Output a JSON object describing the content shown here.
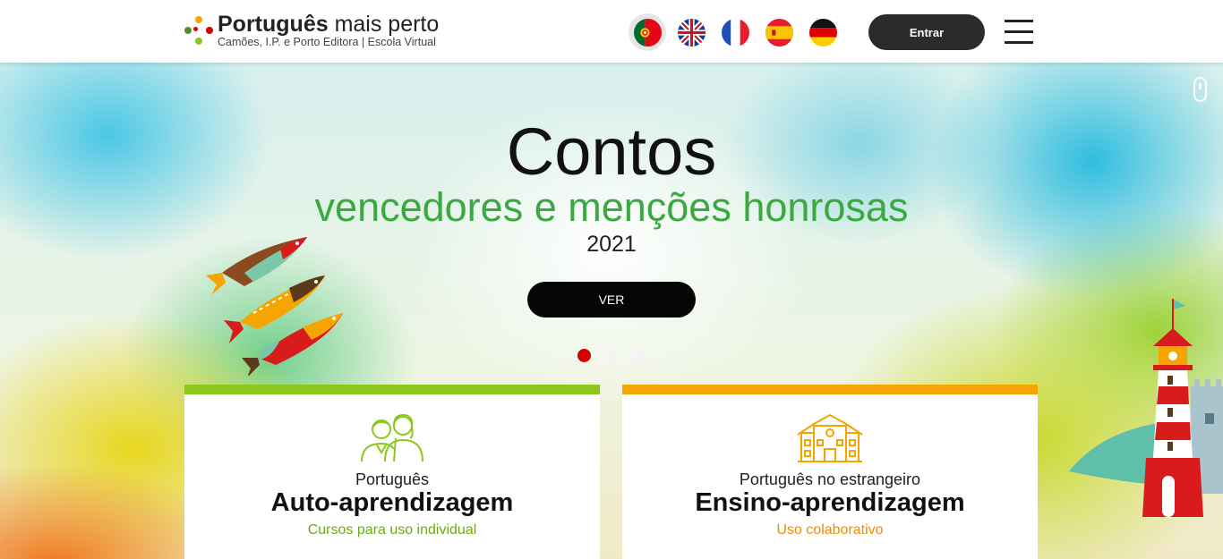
{
  "header": {
    "logo_title_bold": "Português",
    "logo_title_rest": " mais perto",
    "logo_subtitle": "Camões, I.P. e Porto Editora | Escola Virtual",
    "flags": [
      {
        "name": "portuguese",
        "active": true
      },
      {
        "name": "english",
        "active": false
      },
      {
        "name": "french",
        "active": false
      },
      {
        "name": "spanish",
        "active": false
      },
      {
        "name": "german",
        "active": false
      }
    ],
    "login_label": "Entrar",
    "menu_icon": "hamburger-menu-icon"
  },
  "hero": {
    "title": "Contos",
    "subtitle": "vencedores e menções honrosas",
    "year": "2021",
    "button_label": "VER",
    "slides": 3,
    "active_slide": 1
  },
  "cards": [
    {
      "accent": "#8cc71d",
      "icon": "people-icon",
      "pre": "Português",
      "title": "Auto-aprendizagem",
      "note": "Cursos para uso individual"
    },
    {
      "accent": "#f5a400",
      "icon": "school-icon",
      "pre": "Português no estrangeiro",
      "title": "Ensino-aprendizagem",
      "note": "Uso colaborativo"
    }
  ],
  "colors": {
    "green": "#3aa93f",
    "card_green": "#8cc71d",
    "card_orange": "#f5a400",
    "dot_active": "#d50000",
    "dark_button": "#2b2b2b"
  }
}
